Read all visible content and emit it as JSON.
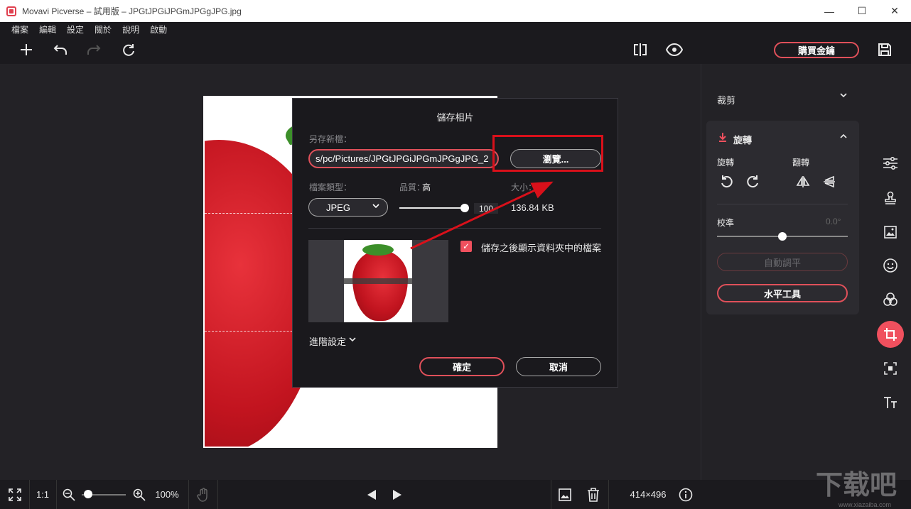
{
  "window": {
    "title": "Movavi Picverse – 試用版 – JPGtJPGiJPGmJPGgJPG.jpg",
    "minimize": "—",
    "maximize": "☐",
    "close": "✕"
  },
  "menu": [
    "檔案",
    "編輯",
    "設定",
    "關於",
    "說明",
    "啟動"
  ],
  "toolbar": {
    "buy_label": "購買金鑰"
  },
  "right_panel": {
    "crop_label": "裁剪",
    "rotate_section": "旋轉",
    "rotate_label": "旋轉",
    "flip_label": "翻轉",
    "calibrate_label": "校準",
    "calibrate_value": "0.0°",
    "calibrate_level": 0.5,
    "auto_level_label": "自動調平",
    "horizon_tool_label": "水平工具"
  },
  "bottom": {
    "ratio_label": "1:1",
    "zoom_value": "100%",
    "zoom_level": 0.15,
    "dimensions": "414×496"
  },
  "dialog": {
    "title": "儲存相片",
    "save_as_label": "另存新檔：",
    "path_value": "s/pc/Pictures/JPGtJPGiJPGmJPGgJPG_2",
    "browse_label": "瀏覽...",
    "file_type_label": "檔案類型：",
    "file_type_value": "JPEG",
    "quality_label": "品質：",
    "quality_word": "高",
    "quality_value": "100",
    "quality_level": 1.0,
    "size_label": "大小：",
    "size_value": "136.84 KB",
    "show_folder_label": "儲存之後顯示資料夾中的檔案",
    "show_folder_checked": true,
    "advanced_label": "進階設定",
    "ok_label": "確定",
    "cancel_label": "取消"
  },
  "watermark": {
    "text": "下载吧",
    "sub": "www.xiazaiba.com"
  },
  "colors": {
    "accent": "#f0505e",
    "highlight": "#d9101a",
    "background": "#232226"
  }
}
